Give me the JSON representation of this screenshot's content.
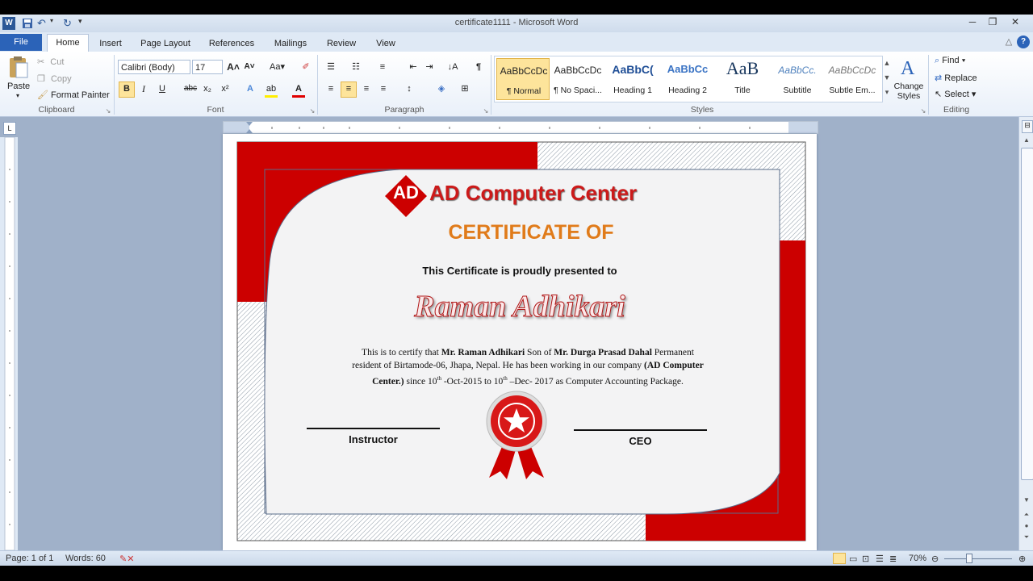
{
  "window": {
    "title": "certificate1111  -  Microsoft Word"
  },
  "tabs": [
    "File",
    "Home",
    "Insert",
    "Page Layout",
    "References",
    "Mailings",
    "Review",
    "View"
  ],
  "clipboard": {
    "paste": "Paste",
    "cut": "Cut",
    "copy": "Copy",
    "format_painter": "Format Painter",
    "label": "Clipboard"
  },
  "font": {
    "name": "Calibri (Body)",
    "size": "17",
    "label": "Font",
    "bold": "B",
    "italic": "I",
    "underline": "U",
    "strike": "abc",
    "sub": "x₂",
    "sup": "x²"
  },
  "paragraph": {
    "label": "Paragraph"
  },
  "styles": {
    "label": "Styles",
    "items": [
      {
        "sample": "AaBbCcDc",
        "name": "¶ Normal"
      },
      {
        "sample": "AaBbCcDc",
        "name": "¶ No Spaci..."
      },
      {
        "sample": "AaBbC(",
        "name": "Heading 1"
      },
      {
        "sample": "AaBbCc",
        "name": "Heading 2"
      },
      {
        "sample": "AaB",
        "name": "Title"
      },
      {
        "sample": "AaBbCc.",
        "name": "Subtitle"
      },
      {
        "sample": "AaBbCcDc",
        "name": "Subtle Em..."
      }
    ],
    "change_styles": "Change Styles"
  },
  "editing": {
    "find": "Find",
    "replace": "Replace",
    "select": "Select",
    "label": "Editing"
  },
  "certificate": {
    "logo_letters": "AD",
    "company": "AD Computer Center",
    "heading": "CERTIFICATE OF",
    "presented": "This Certificate is proudly presented to",
    "recipient": "Raman Adhikari",
    "body_line1_a": "This is to certify that ",
    "body_line1_b": "Mr. Raman Adhikari",
    "body_line1_c": " Son of ",
    "body_line1_d": "Mr. Durga Prasad Dahal",
    "body_line1_e": " Permanent",
    "body_line2_a": "resident of Birtamode-06, Jhapa, Nepal. He has been working in our company ",
    "body_line2_b": "(AD Computer",
    "body_line3_a": "Center.)",
    "body_line3_b": " since 10",
    "body_line3_sup1": "th",
    "body_line3_c": " -Oct-2015 to 10",
    "body_line3_sup2": "th",
    "body_line3_d": " –Dec- 2017 as Computer Accounting Package.",
    "sign_left": "Instructor",
    "sign_right": "CEO"
  },
  "status": {
    "page": "Page: 1 of 1",
    "words": "Words: 60",
    "zoom": "70%"
  },
  "colors": {
    "accent_red": "#cc0000",
    "heading_orange": "#e07b1a",
    "ribbon_blue": "#2b63b8"
  }
}
